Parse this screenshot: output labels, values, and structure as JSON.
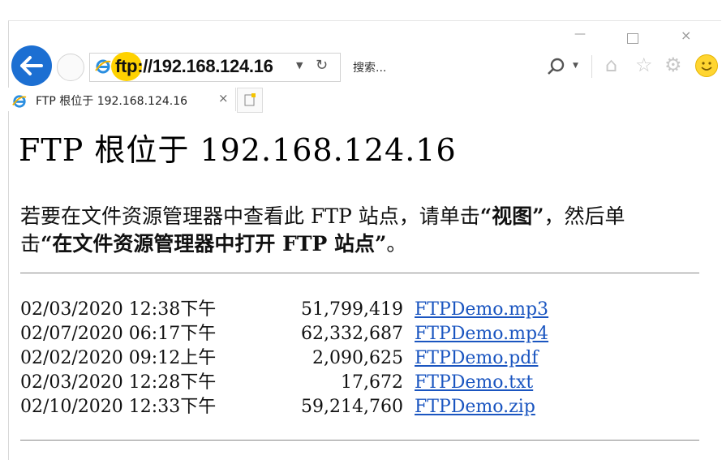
{
  "window": {
    "minimize": "—",
    "close": "×"
  },
  "nav": {
    "url": "ftp://192.168.124.16",
    "search_placeholder": "搜索..."
  },
  "tab": {
    "title": "FTP 根位于 192.168.124.16",
    "close": "×"
  },
  "page": {
    "title": "FTP 根位于 192.168.124.16",
    "instructions_part1": "若要在文件资源管理器中查看此 FTP 站点，请单击",
    "instructions_view": "“视图”",
    "instructions_part2": "，然后单击",
    "instructions_open": "“在文件资源管理器中打开 FTP 站点”",
    "instructions_end": "。",
    "files": [
      {
        "date": "02/03/2020 12:38下午",
        "size": "51,799,419",
        "name": "FTPDemo.mp3"
      },
      {
        "date": "02/07/2020 06:17下午",
        "size": "62,332,687",
        "name": "FTPDemo.mp4"
      },
      {
        "date": "02/02/2020 09:12上午",
        "size": "2,090,625",
        "name": "FTPDemo.pdf"
      },
      {
        "date": "02/03/2020 12:28下午",
        "size": "17,672",
        "name": "FTPDemo.txt"
      },
      {
        "date": "02/10/2020 12:33下午",
        "size": "59,214,760",
        "name": "FTPDemo.zip"
      }
    ]
  },
  "colors": {
    "accent": "#1c6fd2",
    "link": "#1a55c0",
    "highlight": "#ffd200"
  },
  "icons": [
    "back-arrow-icon",
    "forward-icon",
    "ie-icon",
    "refresh-icon",
    "search-icon",
    "home-icon",
    "star-icon",
    "gear-icon",
    "smiley-icon",
    "new-tab-icon"
  ]
}
